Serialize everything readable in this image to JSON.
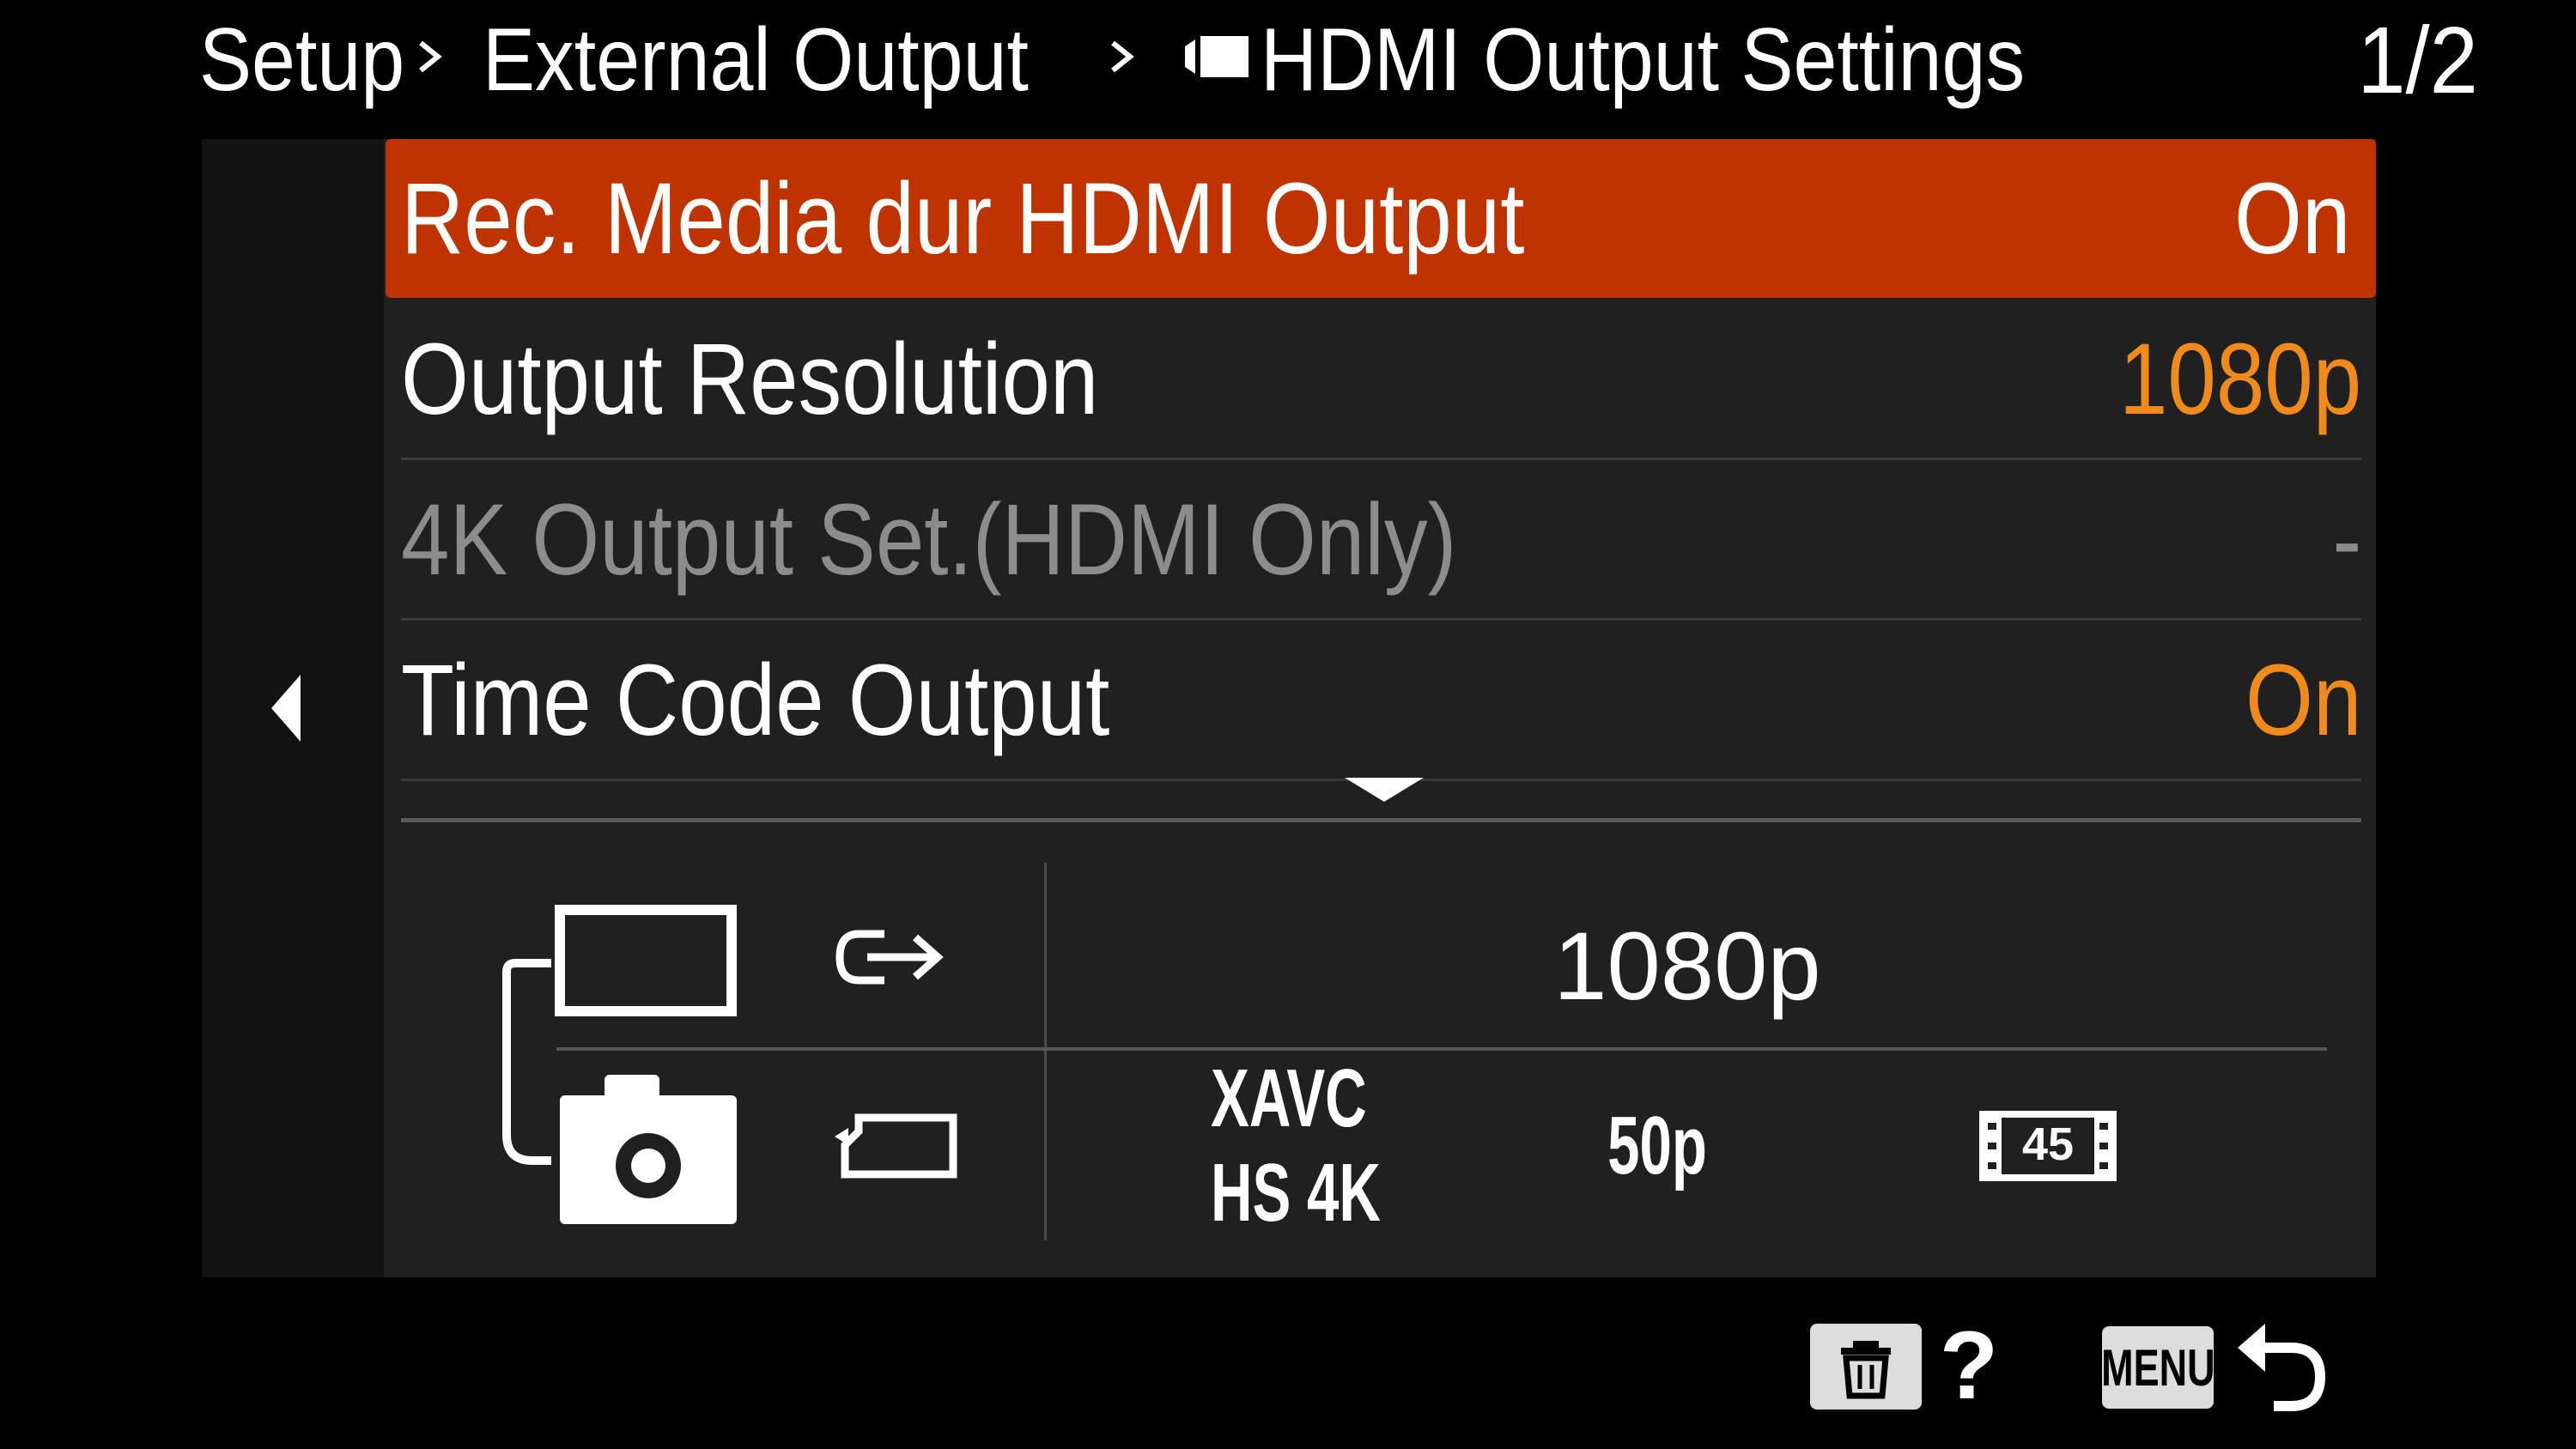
{
  "header": {
    "breadcrumb": [
      "Setup",
      "External Output",
      "HDMI Output Settings"
    ],
    "page_indicator": "1/2"
  },
  "menu": {
    "rows": [
      {
        "label": "Rec. Media dur HDMI Output",
        "value": "On"
      },
      {
        "label": "Output Resolution",
        "value": "1080p"
      },
      {
        "label": "4K Output Set.(HDMI Only)",
        "value": "-"
      },
      {
        "label": "Time Code Output",
        "value": "On"
      }
    ],
    "selected_index": 0
  },
  "info": {
    "output_resolution": "1080p",
    "recording_format": "XAVC HS 4K",
    "frame_rate": "50p",
    "bitrate_badge": "45"
  },
  "footer": {
    "help": "?",
    "menu_label": "MENU"
  },
  "icons": {
    "nav_prev": "left-triangle-icon",
    "more": "down-triangle-icon",
    "delete": "trash-icon",
    "back": "return-arrow-icon",
    "hdmi": "hdmi-output-icon",
    "media": "memory-card-icon",
    "camera": "camera-icon",
    "movie": "movie-mode-icon"
  },
  "colors": {
    "selection": "#bf3300",
    "value_accent": "#f08a1a",
    "disabled": "#8c8c8c"
  }
}
